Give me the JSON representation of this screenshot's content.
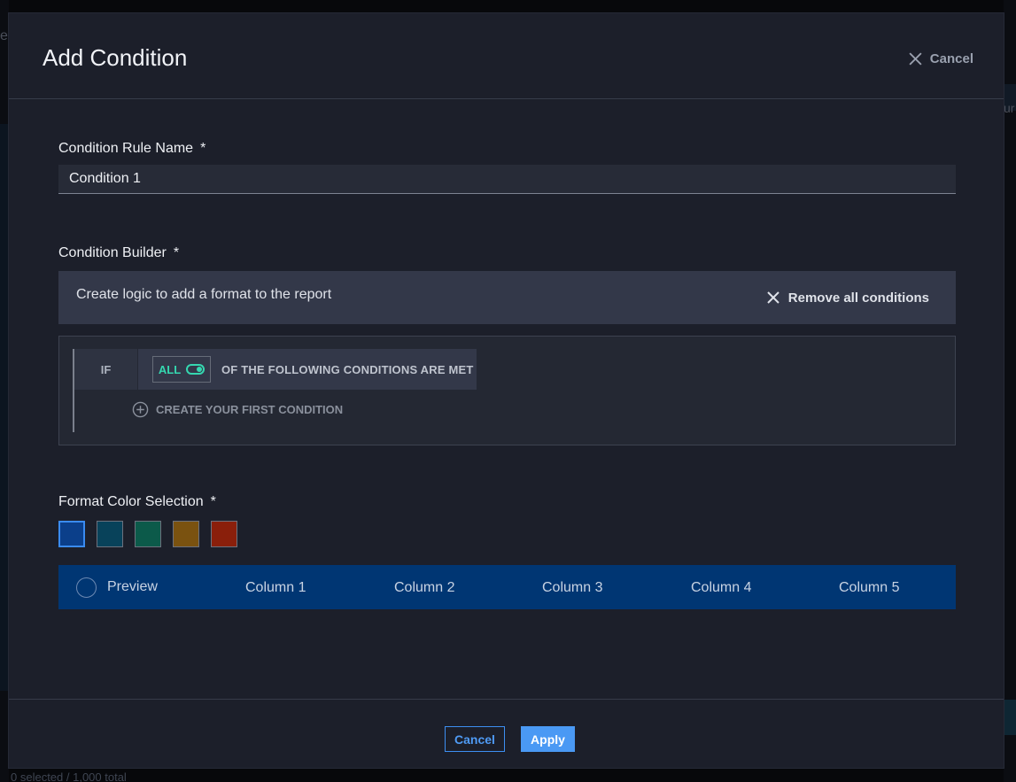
{
  "background": {
    "footer_text": "0 selected / 1,000 total",
    "left_partial_char": "e",
    "right_partial_text": "ur"
  },
  "modal": {
    "title": "Add Condition",
    "header_cancel_label": "Cancel",
    "rule_name": {
      "label": "Condition Rule Name",
      "required_mark": "*",
      "value": "Condition 1"
    },
    "condition_builder": {
      "label": "Condition Builder",
      "required_mark": "*",
      "description": "Create logic to add a format to the report",
      "remove_all_label": "Remove all conditions",
      "if_label": "IF",
      "match_mode": "ALL",
      "match_mode_enabled": true,
      "following_text": "OF THE FOLLOWING CONDITIONS ARE MET",
      "create_first_label": "CREATE YOUR FIRST CONDITION"
    },
    "format_color": {
      "label": "Format Color Selection",
      "required_mark": "*",
      "swatches": [
        {
          "name": "blue",
          "color": "#0b3f8a",
          "selected": true
        },
        {
          "name": "teal",
          "color": "#08425a",
          "selected": false
        },
        {
          "name": "green",
          "color": "#0c5a4a",
          "selected": false
        },
        {
          "name": "amber",
          "color": "#7a5210",
          "selected": false
        },
        {
          "name": "red",
          "color": "#8a1f0b",
          "selected": false
        }
      ]
    },
    "preview": {
      "label": "Preview",
      "columns": [
        "Column 1",
        "Column 2",
        "Column 3",
        "Column 4",
        "Column 5"
      ],
      "background": "#003673"
    },
    "footer": {
      "cancel_label": "Cancel",
      "apply_label": "Apply"
    }
  },
  "colors": {
    "accent": "#4a99f4",
    "toggle": "#35d7b0",
    "modal_bg": "#1c1f2a"
  }
}
